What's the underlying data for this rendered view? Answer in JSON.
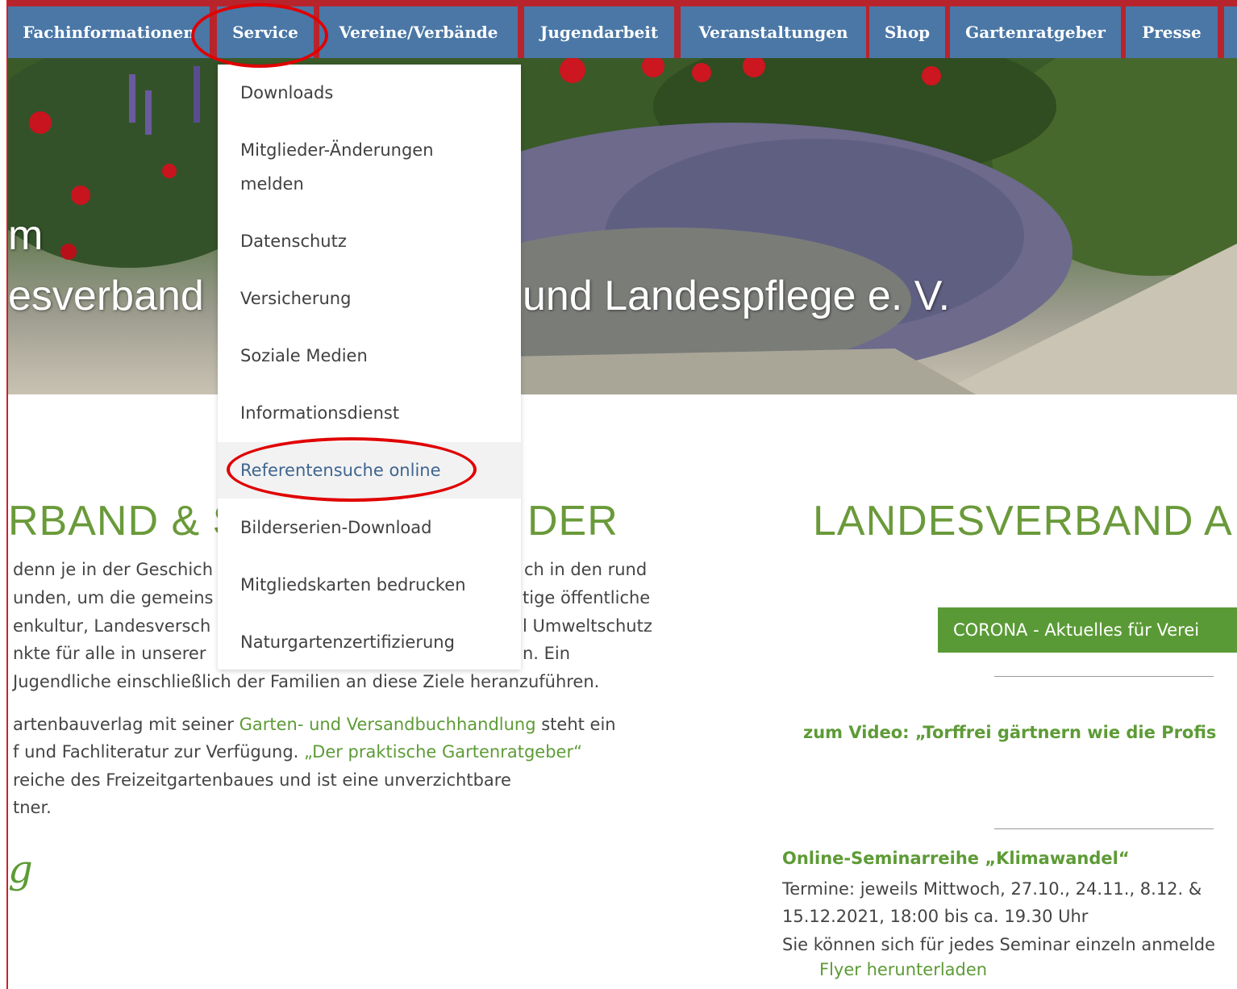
{
  "nav": {
    "items": [
      "Fachinformationen",
      "Service",
      "Vereine/Verbände",
      "Jugendarbeit",
      "Veranstaltungen",
      "Shop",
      "Gartenratgeber",
      "Presse"
    ]
  },
  "hero": {
    "line1": "m",
    "line2_left": "esverband",
    "line2_right": "und Landespflege e. V."
  },
  "dropdown": {
    "items": [
      "Downloads",
      "Mitglieder-Änderungen",
      "melden",
      "Datenschutz",
      "Versicherung",
      "Soziale Medien",
      "Informationsdienst",
      "Referentensuche online",
      "Bilderserien-Download",
      "Mitgliedskarten bedrucken",
      "Naturgartenzertifizierung"
    ],
    "active_index": 7
  },
  "left_column": {
    "heading_left": "RBAND & S",
    "heading_right": "DER",
    "para1": [
      "denn je in der Geschich",
      "unden, um die gemeins",
      "enkultur, Landesversch",
      "nkte für alle in unserer",
      "Jugendliche einschließlich der Familien an diese Ziele heranzuführen."
    ],
    "para1_right": [
      "ch in den rund",
      "tige öffentliche",
      "l Umweltschutz",
      "n. Ein"
    ],
    "para2_line1_pre": "artenbauverlag mit seiner ",
    "para2_line1_link": "Garten- und Versandbuchhandlung",
    "para2_line1_post": " steht ein",
    "para2_line2_pre": "f und Fachliteratur zur Verfügung. ",
    "para2_line2_link": "„Der praktische Gartenratgeber“",
    "para2_line3": "reiche des Freizeitgartenbaues und ist eine unverzichtbare",
    "para2_line4": "tner.",
    "signature": "g"
  },
  "right_column": {
    "heading": "LANDESVERBAND A",
    "corona_button": "CORONA - Aktuelles für Verei",
    "video_link": "zum Video: „Torffrei gärtnern wie die Profis",
    "seminar_title": "Online-Seminarreihe „Klimawandel“",
    "seminar_lines": [
      "Termine: jeweils Mittwoch, 27.10., 24.11., 8.12. &",
      "15.12.2021, 18:00 bis ca. 19.30 Uhr",
      "Sie können sich für jedes Seminar einzeln anmelde"
    ],
    "flyer_link": "Flyer herunterladen"
  },
  "colors": {
    "nav_bg": "#4a77a6",
    "nav_strip": "#b8242c",
    "accent_green": "#5d9b36",
    "annotation_red": "#e00000"
  }
}
